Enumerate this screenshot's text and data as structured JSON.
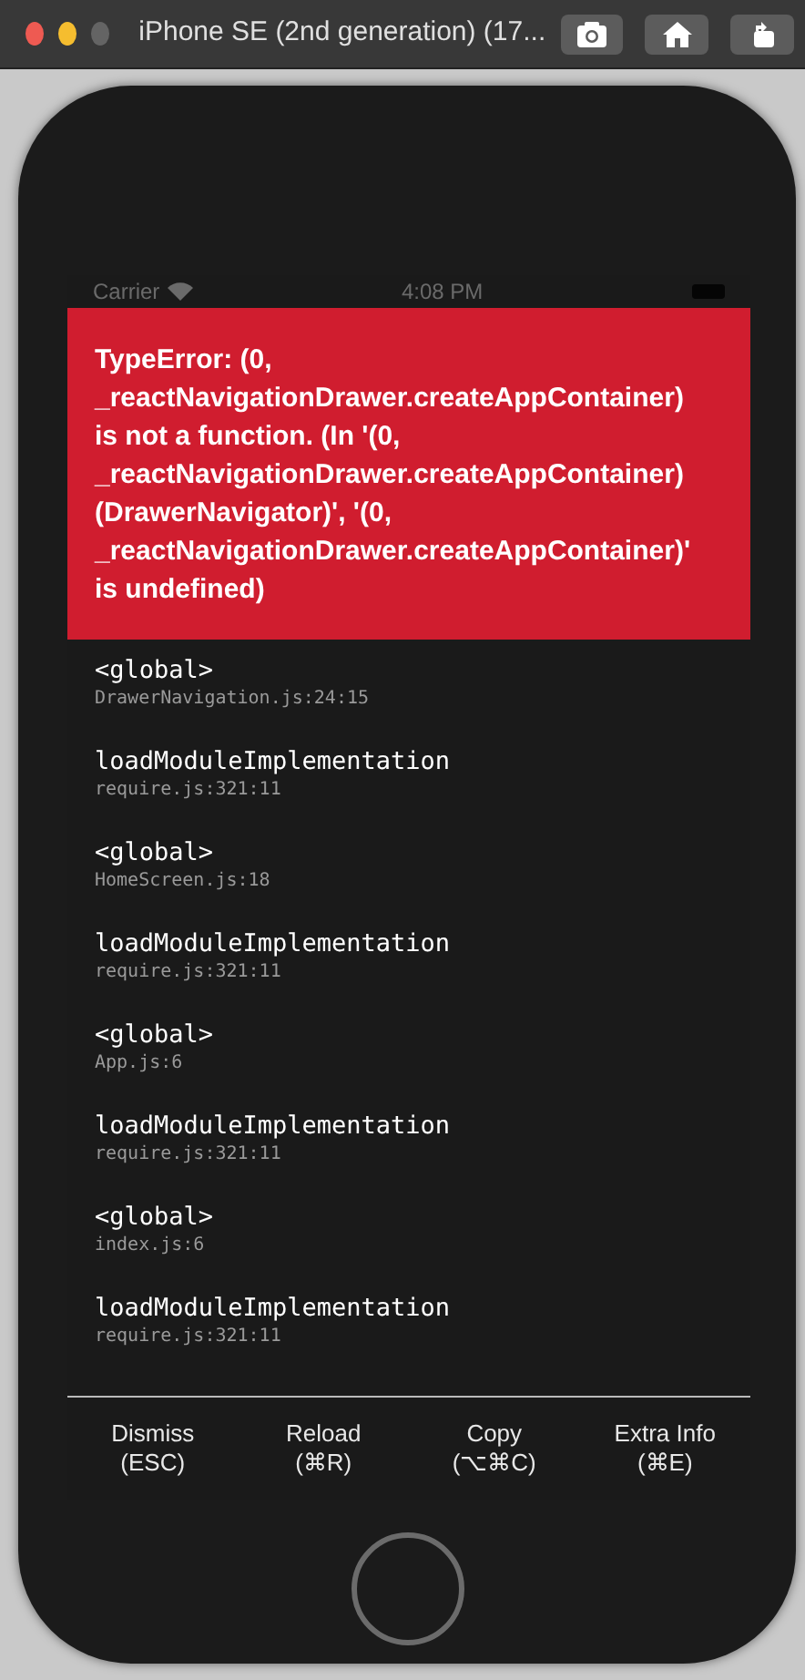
{
  "window": {
    "title": "iPhone SE (2nd generation) (17..."
  },
  "status_bar": {
    "carrier": "Carrier",
    "time": "4:08 PM"
  },
  "error": {
    "message": "TypeError: (0, _reactNavigationDrawer.createAppContainer) is not a function. (In '(0, _reactNavigationDrawer.createAppContainer)(DrawerNavigator)', '(0, _reactNavigationDrawer.createAppContainer)' is undefined)"
  },
  "stack": [
    {
      "method": "<global>",
      "location": "DrawerNavigation.js:24:15"
    },
    {
      "method": "loadModuleImplementation",
      "location": "require.js:321:11"
    },
    {
      "method": "<global>",
      "location": "HomeScreen.js:18"
    },
    {
      "method": "loadModuleImplementation",
      "location": "require.js:321:11"
    },
    {
      "method": "<global>",
      "location": "App.js:6"
    },
    {
      "method": "loadModuleImplementation",
      "location": "require.js:321:11"
    },
    {
      "method": "<global>",
      "location": "index.js:6"
    },
    {
      "method": "loadModuleImplementation",
      "location": "require.js:321:11"
    }
  ],
  "buttons": [
    {
      "label": "Dismiss",
      "shortcut": "(ESC)"
    },
    {
      "label": "Reload",
      "shortcut": "(⌘R)"
    },
    {
      "label": "Copy",
      "shortcut": "(⌥⌘C)"
    },
    {
      "label": "Extra Info",
      "shortcut": "(⌘E)"
    }
  ]
}
